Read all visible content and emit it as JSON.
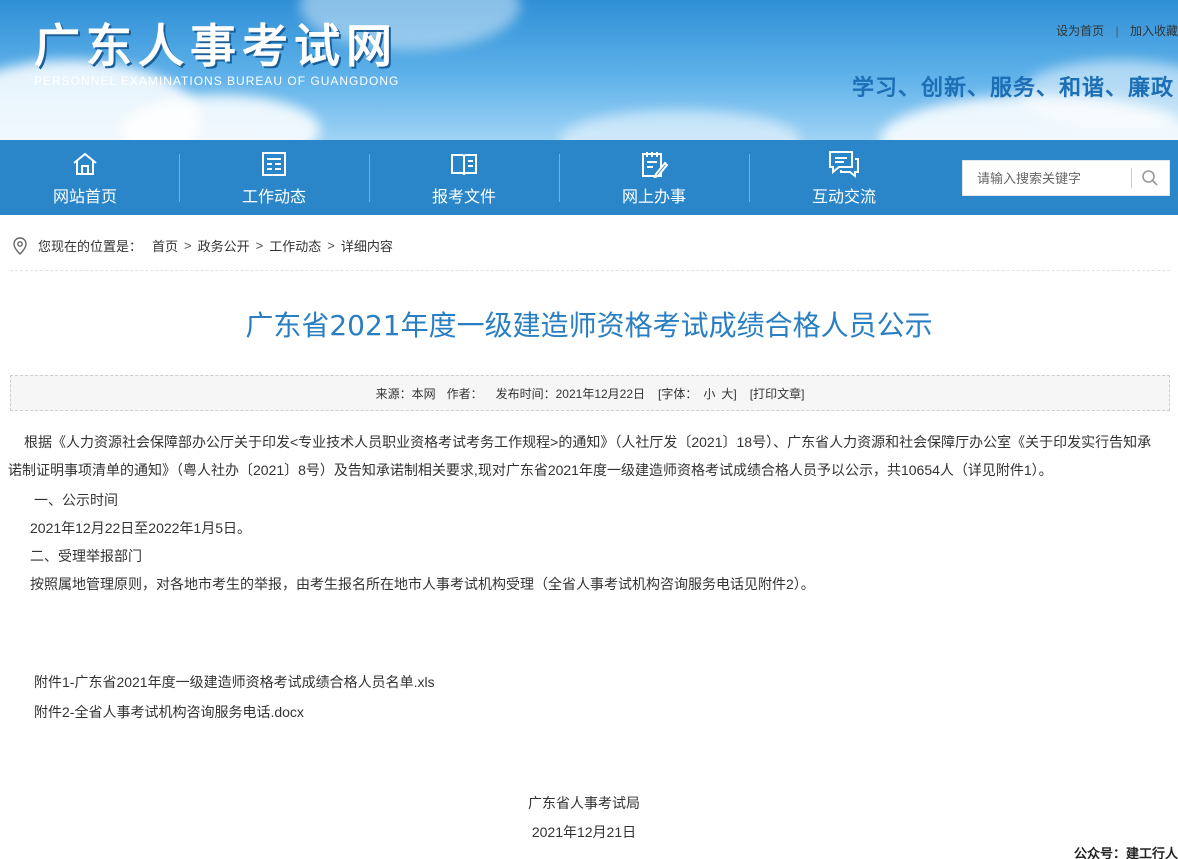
{
  "header": {
    "logo_title": "广东人事考试网",
    "logo_subtitle": "PERSONNEL EXAMINATIONS BUREAU OF GUANGDONG",
    "top_links": [
      "设为首页",
      "加入收藏"
    ],
    "top_link_separator": "|",
    "slogan": "学习、创新、服务、和谐、廉政"
  },
  "nav": {
    "items": [
      {
        "label": "网站首页",
        "icon": "home-icon"
      },
      {
        "label": "工作动态",
        "icon": "news-list-icon"
      },
      {
        "label": "报考文件",
        "icon": "book-icon"
      },
      {
        "label": "网上办事",
        "icon": "clipboard-pen-icon"
      },
      {
        "label": "互动交流",
        "icon": "chat-bubbles-icon"
      }
    ],
    "search_placeholder": "请输入搜索关键字"
  },
  "breadcrumb": {
    "prefix": "您现在的位置是：",
    "items": [
      "首页",
      "政务公开",
      "工作动态",
      "详细内容"
    ],
    "separator": ">"
  },
  "article": {
    "title": "广东省2021年度一级建造师资格考试成绩合格人员公示",
    "meta": {
      "source": "来源：本网",
      "author": "作者：",
      "publish_time": "发布时间：2021年12月22日",
      "font_size_label": "[字体：",
      "font_small": "小",
      "font_large": "大]",
      "print": "[打印文章]"
    },
    "paragraphs": [
      "根据《人力资源社会保障部办公厅关于印发<专业技术人员职业资格考试考务工作规程>的通知》（人社厅发〔2021〕18号）、广东省人力资源和社会保障厅办公室《关于印发实行告知承诺制证明事项清单的通知》（粤人社办〔2021〕8号）及告知承诺制相关要求,现对广东省2021年度一级建造师资格考试成绩合格人员予以公示，共10654人（详见附件1）。",
      "一、公示时间",
      "2021年12月22日至2022年1月5日。",
      "二、受理举报部门",
      "按照属地管理原则，对各地市考生的举报，由考生报名所在地市人事考试机构受理（全省人事考试机构咨询服务电话见附件2）。"
    ],
    "attachments": [
      "附件1-广东省2021年度一级建造师资格考试成绩合格人员名单.xls",
      "附件2-全省人事考试机构咨询服务电话.docx"
    ],
    "signature": "广东省人事考试局",
    "date": "2021年12月21日"
  },
  "watermark": "公众号：建工行人",
  "colors": {
    "nav_bg": "#2a86c9",
    "title_blue": "#2a7ec2",
    "slogan_blue": "#1c6fb5"
  }
}
